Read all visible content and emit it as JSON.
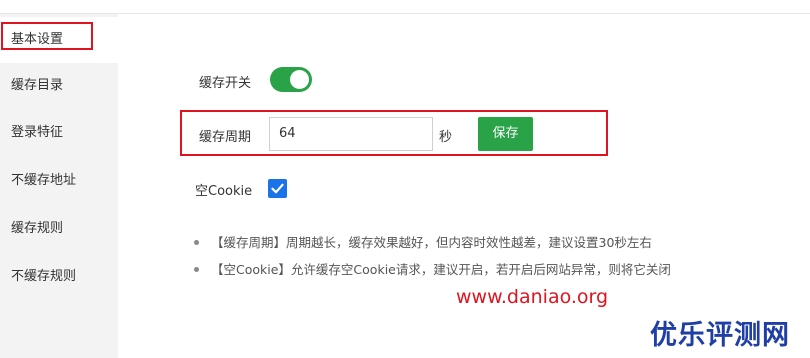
{
  "sidebar": {
    "items": [
      {
        "label": "基本设置",
        "active": true
      },
      {
        "label": "缓存目录"
      },
      {
        "label": "登录特征"
      },
      {
        "label": "不缓存地址"
      },
      {
        "label": "缓存规则"
      },
      {
        "label": "不缓存规则"
      }
    ]
  },
  "settings": {
    "cache_switch_label": "缓存开关",
    "cache_switch_on": true,
    "cache_period_label": "缓存周期",
    "cache_period_value": "64",
    "cache_period_unit": "秒",
    "save_label": "保存",
    "empty_cookie_label": "空Cookie",
    "empty_cookie_checked": true
  },
  "notes": [
    "【缓存周期】周期越长，缓存效果越好，但内容时效性越差，建议设置30秒左右",
    "【空Cookie】允许缓存空Cookie请求，建议开启，若开启后网站异常，则将它关闭"
  ],
  "watermark": {
    "url": "www.daniao.org",
    "brand": "优乐评测网"
  },
  "colors": {
    "accent_green": "#2aa248",
    "highlight_red": "#e0141e",
    "checkbox_blue": "#1a73e8",
    "brand_blue": "#1f3fa6"
  }
}
